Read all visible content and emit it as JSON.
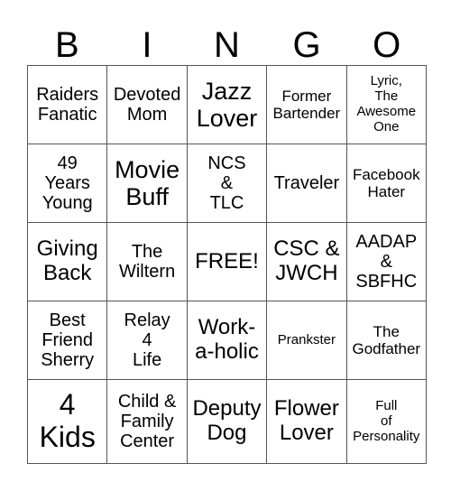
{
  "header": {
    "letters": [
      "B",
      "I",
      "N",
      "G",
      "O"
    ]
  },
  "board": {
    "rows": [
      [
        "Raiders\nFanatic",
        "Devoted\nMom",
        "Jazz\nLover",
        "Former\nBartender",
        "Lyric,\nThe\nAwesome\nOne"
      ],
      [
        "49\nYears\nYoung",
        "Movie\nBuff",
        "NCS\n&\nTLC",
        "Traveler",
        "Facebook\nHater"
      ],
      [
        "Giving\nBack",
        "The\nWiltern",
        "FREE!",
        "CSC &\nJWCH",
        "AADAP\n&\nSBFHC"
      ],
      [
        "Best\nFriend\nSherry",
        "Relay\n4\nLife",
        "Work-\na-holic",
        "Prankster",
        "The\nGodfather"
      ],
      [
        "4\nKids",
        "Child &\nFamily\nCenter",
        "Deputy\nDog",
        "Flower\nLover",
        "Full\nof\nPersonality"
      ]
    ]
  }
}
